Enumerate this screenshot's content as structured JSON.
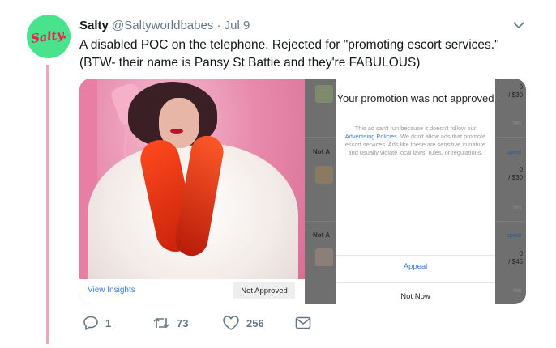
{
  "tweet": {
    "avatar_text": "Salty.",
    "author_name": "Salty",
    "author_handle": "@Saltyworldbabes",
    "separator": "·",
    "date": "Jul 9",
    "text_line1": "A disabled POC on the telephone. Rejected for \"promoting escort services.\"",
    "text_line2": "(BTW-  their name is Pansy St Battie and they're FABULOUS)"
  },
  "media": {
    "photo_panel": {
      "view_insights": "View Insights",
      "status_button": "Not Approved"
    },
    "modal": {
      "title": "Your promotion was not approved",
      "body_before_link": "This ad can't run because it doesn't follow our ",
      "body_link": "Advertising Policies",
      "body_after_link": ". We don't allow ads that promote escort services. Ads like these are sensitive in nature and usually violate local laws, rules, or regulations.",
      "primary_action": "Appeal",
      "secondary_action": "Not Now"
    },
    "background_list": {
      "row1_count": "0",
      "row1_budget": "/ $30",
      "row1_link": "hts",
      "row2_label": "Not A",
      "row2_appeal": "ppeal",
      "row2_count": "0",
      "row2_budget": "/ $30",
      "row2_link": "hts",
      "row3_label": "Not A",
      "row3_appeal": "ppeal",
      "row3_count": "0",
      "row3_budget": "/ $45",
      "row3_link": "hts"
    }
  },
  "actions": {
    "replies": "1",
    "retweets": "73",
    "likes": "256"
  },
  "colors": {
    "avatar_bg": "#49e38e",
    "avatar_text": "#e8234d",
    "thread_line": "#e8a7c2",
    "link_blue": "#3f7fd6",
    "muted_gray": "#657786"
  }
}
